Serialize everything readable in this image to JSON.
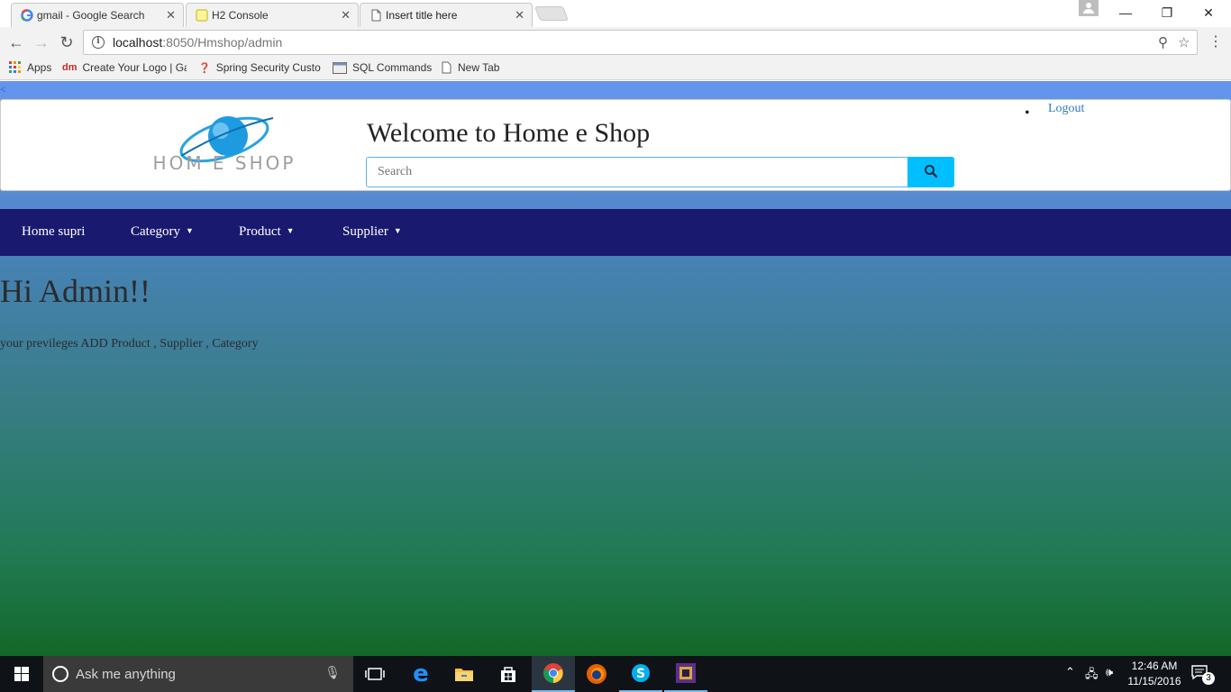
{
  "browser": {
    "tabs": [
      {
        "label": "gmail - Google Search",
        "icon": "google-icon",
        "active": false
      },
      {
        "label": "H2 Console",
        "icon": "h2-icon",
        "active": false
      },
      {
        "label": "Insert title here",
        "icon": "page-icon",
        "active": true
      }
    ],
    "url_host": "localhost",
    "url_path": ":8050/Hmshop/admin",
    "bookmarks": [
      {
        "label": "Apps",
        "icon": "apps-grid-icon"
      },
      {
        "label": "Create Your Logo | Ga",
        "icon": "designmantic-icon"
      },
      {
        "label": "Spring Security Custo",
        "icon": "spring-icon"
      },
      {
        "label": "SQL Commands",
        "icon": "sql-icon"
      },
      {
        "label": "New Tab",
        "icon": "page-icon"
      }
    ]
  },
  "page": {
    "back_link": "<",
    "welcome": "Welcome to Home e Shop",
    "search_placeholder": "Search",
    "logo_text": "HOM E SHOP",
    "logout": "Logout",
    "nav": [
      {
        "label": "Home supri",
        "dropdown": false
      },
      {
        "label": "Category",
        "dropdown": true
      },
      {
        "label": "Product",
        "dropdown": true
      },
      {
        "label": "Supplier",
        "dropdown": true
      }
    ],
    "greeting": "Hi Admin!!",
    "privileges": "your previleges ADD Product , Supplier , Category",
    "colors": {
      "top_band": "#6495ed",
      "navbar": "#191970",
      "search_button": "#00bfff",
      "link": "#337ab7"
    }
  },
  "taskbar": {
    "search_text": "Ask me anything",
    "time": "12:46 AM",
    "date": "11/15/2016",
    "notifications": "3",
    "apps": [
      "task-view-icon",
      "edge-icon",
      "file-explorer-icon",
      "store-icon",
      "chrome-icon",
      "firefox-icon",
      "skype-icon",
      "app-icon"
    ]
  }
}
